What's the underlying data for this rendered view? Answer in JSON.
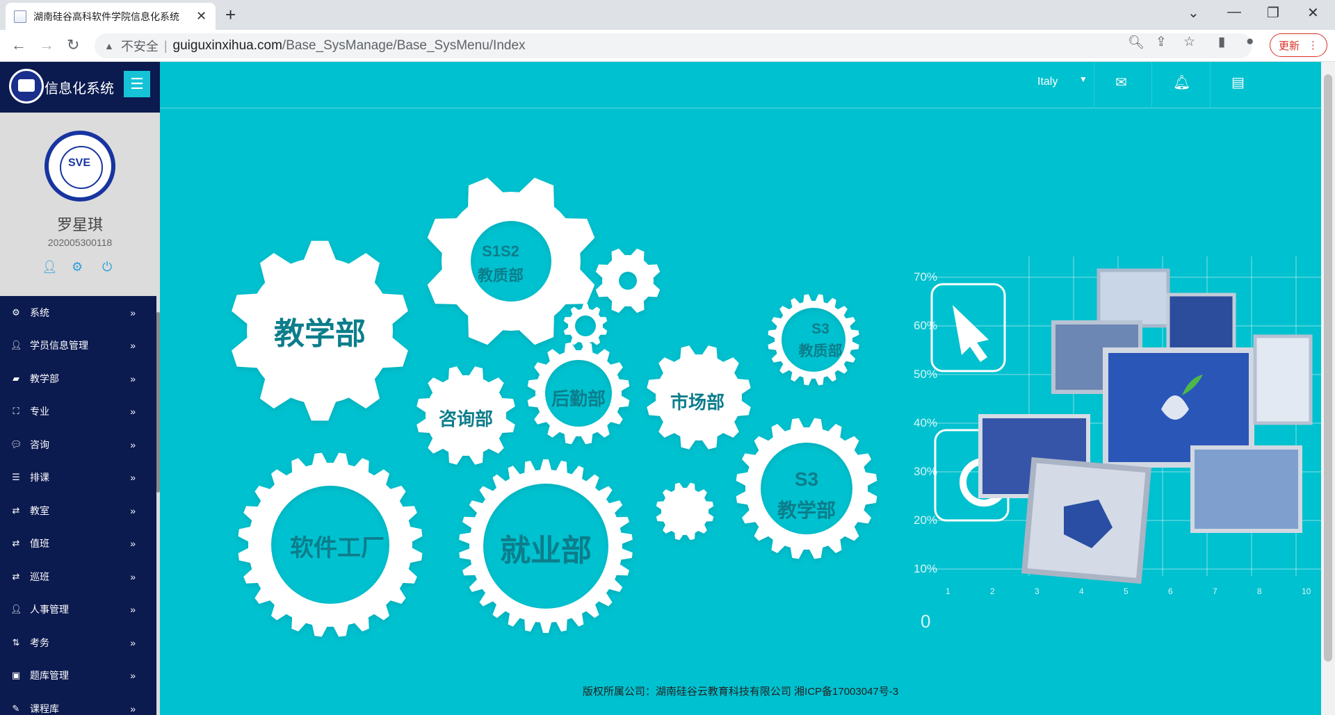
{
  "browser": {
    "tab_title": "湖南硅谷高科软件学院信息化系统",
    "new_tab": "+",
    "back": "←",
    "forward": "→",
    "reload": "↻",
    "security_label": "不安全",
    "url_host": "guiguxinxihua.com",
    "url_path": "/Base_SysManage/Base_SysMenu/Index",
    "update_label": "更新",
    "window_controls": [
      "⌄",
      "—",
      "❐",
      "✕"
    ]
  },
  "sidebar": {
    "brand_title": "信息化系统",
    "user_name": "罗星琪",
    "user_id": "202005300118",
    "menu_items": [
      {
        "label": "系统",
        "icon": "gear-icon"
      },
      {
        "label": "学员信息管理",
        "icon": "user-icon"
      },
      {
        "label": "教学部",
        "icon": "book-icon"
      },
      {
        "label": "专业",
        "icon": "sitemap-icon"
      },
      {
        "label": "咨询",
        "icon": "comments-icon"
      },
      {
        "label": "排课",
        "icon": "list-icon"
      },
      {
        "label": "教室",
        "icon": "retweet-icon"
      },
      {
        "label": "值班",
        "icon": "retweet-icon"
      },
      {
        "label": "巡班",
        "icon": "retweet-icon"
      },
      {
        "label": "人事管理",
        "icon": "user-icon"
      },
      {
        "label": "考务",
        "icon": "sort-numeric-icon"
      },
      {
        "label": "题库管理",
        "icon": "briefcase-icon"
      },
      {
        "label": "课程库",
        "icon": "edit-icon"
      }
    ]
  },
  "topbar": {
    "language": "Italy"
  },
  "gears": {
    "jiaoxuebu": "教学部",
    "s1s2_line1": "S1S2",
    "s1s2_line2": "教质部",
    "s3_jiaozhi_line1": "S3",
    "s3_jiaozhi_line2": "教质部",
    "zixunbu": "咨询部",
    "houqinbu": "后勤部",
    "shichangbu": "市场部",
    "ruanjiangongchang": "软件工厂",
    "jiuyebu": "就业部",
    "s3_jiaoxue_line1": "S3",
    "s3_jiaoxue_line2": "教学部"
  },
  "illustration": {
    "y_ticks": [
      "70%",
      "60%",
      "50%",
      "40%",
      "30%",
      "20%",
      "10%",
      "0"
    ],
    "x_ticks": [
      "1",
      "2",
      "3",
      "4",
      "5",
      "6",
      "7",
      "8",
      "10"
    ]
  },
  "footer": "版权所属公司：湖南硅谷云教育科技有限公司 湘ICP备17003047号-3"
}
